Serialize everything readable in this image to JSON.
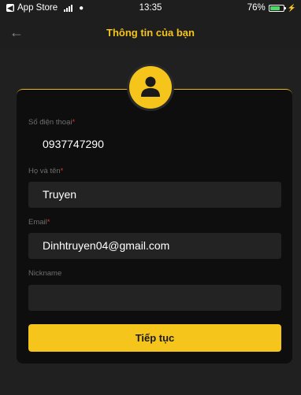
{
  "status_bar": {
    "back_app": "App Store",
    "time": "13:35",
    "battery": "76%",
    "battery_level": 0.76
  },
  "header": {
    "title": "Thông tin của bạn",
    "back_icon": "arrow-left-icon"
  },
  "form": {
    "phone": {
      "label": "Số điện thoại",
      "value": "0937747290"
    },
    "fullname": {
      "label": "Họ và tên",
      "value": "Truyen"
    },
    "email": {
      "label": "Email",
      "value": "Dinhtruyen04@gmail.com"
    },
    "nickname": {
      "label": "Nickname",
      "value": ""
    }
  },
  "continue_label": "Tiếp tục",
  "colors": {
    "accent": "#f5c51c",
    "required": "#e0302d",
    "background": "#1b1b1b"
  }
}
